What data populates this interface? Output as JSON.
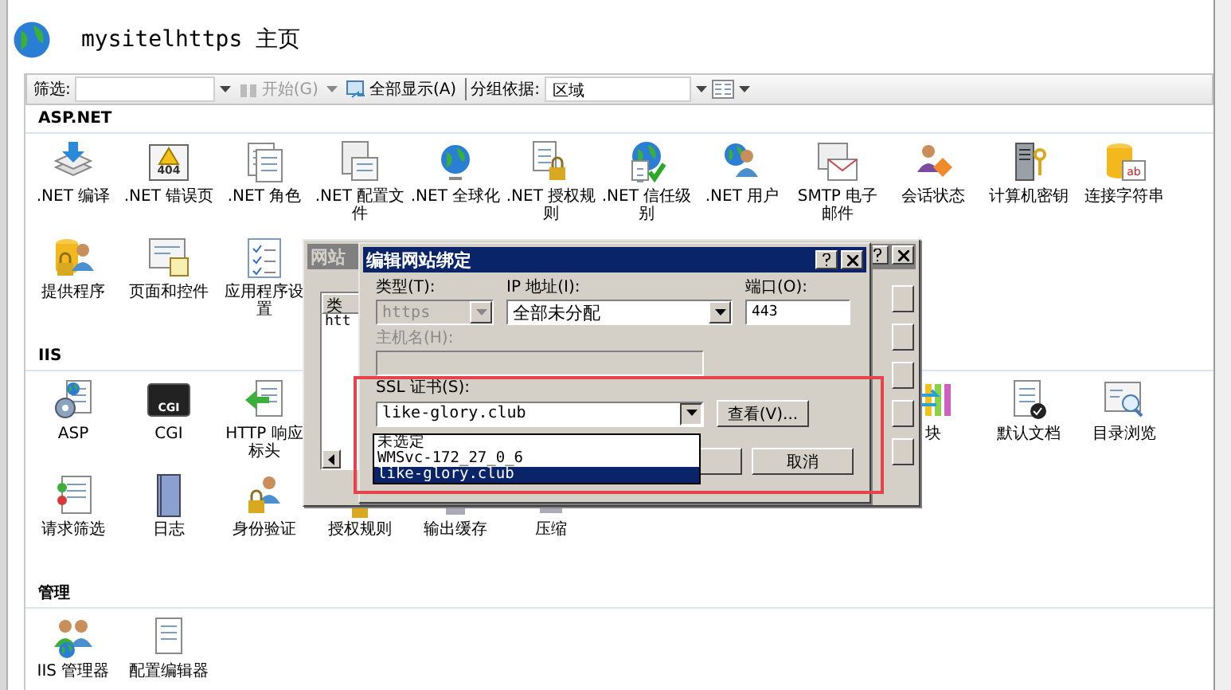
{
  "page": {
    "title": "mysitelhttps 主页"
  },
  "toolbar": {
    "filter_label": "筛选:",
    "go_button": {
      "label": "开始(G)",
      "disabled": true
    },
    "show_all": "全部显示(A)",
    "group_label": "分组依据:",
    "group_value": "区域"
  },
  "sections": [
    {
      "title": "ASP.NET",
      "rows": [
        [
          {
            "kind": "feature",
            "label": ".NET 编译"
          },
          {
            "kind": "feature",
            "label": ".NET 错误页",
            "icon_text": "404"
          },
          {
            "kind": "feature",
            "label": ".NET 角色"
          },
          {
            "kind": "feature",
            "label": ".NET 配置文件"
          },
          {
            "kind": "feature",
            "label": ".NET 全球化"
          },
          {
            "kind": "feature",
            "label": ".NET 授权规则"
          },
          {
            "kind": "feature",
            "label": ".NET 信任级别"
          },
          {
            "kind": "feature",
            "label": ".NET 用户"
          },
          {
            "kind": "feature",
            "label": "SMTP 电子邮件"
          },
          {
            "kind": "feature",
            "label": "会话状态"
          },
          {
            "kind": "feature",
            "label": "计算机密钥"
          },
          {
            "kind": "feature",
            "label": "连接字符串",
            "icon_text": "ab"
          }
        ],
        [
          {
            "kind": "feature",
            "label": "提供程序"
          },
          {
            "kind": "feature",
            "label": "页面和控件"
          },
          {
            "kind": "feature",
            "label": "应用程序设置"
          }
        ]
      ]
    },
    {
      "title": "IIS",
      "rows": [
        [
          {
            "kind": "feature",
            "label": "ASP"
          },
          {
            "kind": "feature",
            "label": "CGI",
            "icon_text": "CGI"
          },
          {
            "kind": "feature",
            "label": "HTTP 响应标头"
          },
          {
            "kind": "covered"
          },
          {
            "kind": "covered"
          },
          {
            "kind": "covered"
          },
          {
            "kind": "covered"
          },
          {
            "kind": "covered"
          },
          {
            "kind": "covered"
          },
          {
            "kind": "feature",
            "label": "块"
          },
          {
            "kind": "feature",
            "label": "默认文档"
          },
          {
            "kind": "feature",
            "label": "目录浏览"
          }
        ],
        [
          {
            "kind": "feature",
            "label": "请求筛选"
          },
          {
            "kind": "feature",
            "label": "日志"
          },
          {
            "kind": "feature",
            "label": "身份验证"
          },
          {
            "kind": "feature",
            "label": "授权规则"
          },
          {
            "kind": "feature",
            "label": "输出缓存"
          },
          {
            "kind": "feature",
            "label": "压缩"
          }
        ]
      ]
    },
    {
      "title": "管理",
      "rows": [
        [
          {
            "kind": "feature",
            "label": "IIS 管理器"
          },
          {
            "kind": "feature",
            "label": "配置编辑器"
          }
        ]
      ]
    }
  ],
  "bindings_dialog": {
    "title": "网站",
    "active": false,
    "column_1": "类",
    "cell": "htt"
  },
  "edit_dialog": {
    "title": "编辑网站绑定",
    "active": true,
    "type": {
      "label": "类型(T):",
      "value": "https",
      "disabled": true
    },
    "ip": {
      "label": "IP 地址(I):",
      "value": "全部未分配",
      "disabled": false
    },
    "port": {
      "label": "端口(O):",
      "value": "443"
    },
    "host": {
      "label": "主机名(H):",
      "disabled": true
    },
    "ssl": {
      "label": "SSL 证书(S):",
      "value": "like-glory.club",
      "expanded": true,
      "options": [
        {
          "label": "未选定",
          "selected": false
        },
        {
          "label": "WMSvc-172_27_0_6",
          "selected": false
        },
        {
          "label": "like-glory.club",
          "selected": true
        }
      ]
    },
    "view_button": "查看(V)...",
    "cancel_button": "取消"
  }
}
